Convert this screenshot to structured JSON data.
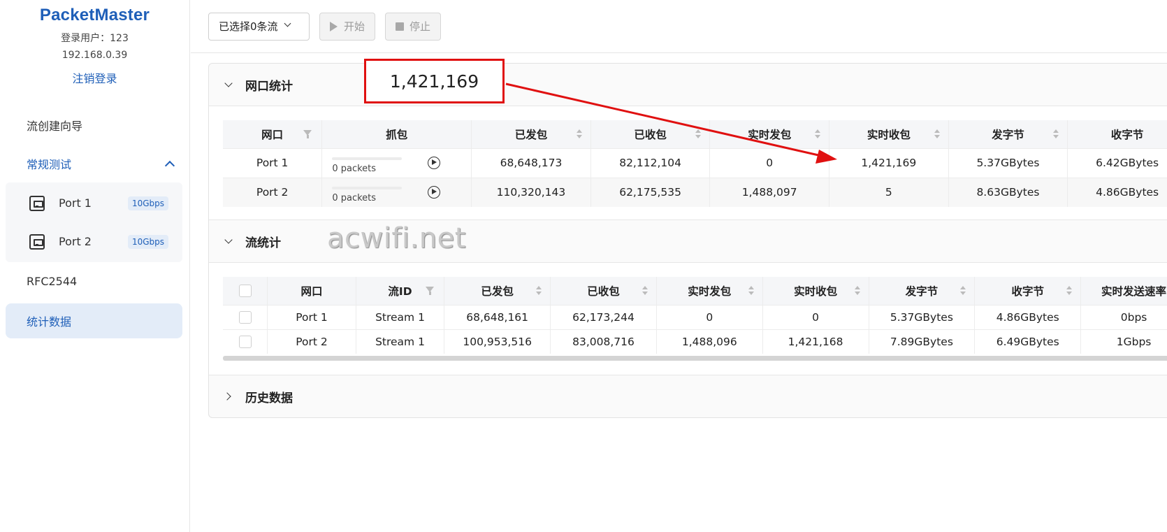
{
  "app": {
    "brand": "PacketMaster",
    "user_line": "登录用户：123",
    "ip": "192.168.0.39",
    "logout": "注销登录"
  },
  "nav": {
    "wizard": "流创建向导",
    "normal_test": "常规测试",
    "ports": [
      {
        "label": "Port 1",
        "speed": "10Gbps"
      },
      {
        "label": "Port 2",
        "speed": "10Gbps"
      }
    ],
    "rfc": "RFC2544",
    "stats": "统计数据"
  },
  "toolbar": {
    "stream_select": "已选择0条流",
    "start": "开始",
    "stop": "停止"
  },
  "port_stats": {
    "title": "网口统计",
    "columns": [
      "网口",
      "抓包",
      "已发包",
      "已收包",
      "实时发包",
      "实时收包",
      "发字节",
      "收字节"
    ],
    "rows": [
      {
        "port": "Port 1",
        "capture": "0 packets",
        "tx": "68,648,173",
        "rx": "82,112,104",
        "rt_tx": "0",
        "rt_rx": "1,421,169",
        "tx_bytes": "5.37GBytes",
        "rx_bytes": "6.42GBytes"
      },
      {
        "port": "Port 2",
        "capture": "0 packets",
        "tx": "110,320,143",
        "rx": "62,175,535",
        "rt_tx": "1,488,097",
        "rt_rx": "5",
        "tx_bytes": "8.63GBytes",
        "rx_bytes": "4.86GBytes"
      }
    ]
  },
  "flow_stats": {
    "title": "流统计",
    "columns": [
      "网口",
      "流ID",
      "已发包",
      "已收包",
      "实时发包",
      "实时收包",
      "发字节",
      "收字节",
      "实时发送速率"
    ],
    "rows": [
      {
        "port": "Port 1",
        "flow": "Stream 1",
        "tx": "68,648,161",
        "rx": "62,173,244",
        "rt_tx": "0",
        "rt_rx": "0",
        "tx_bytes": "5.37GBytes",
        "rx_bytes": "4.86GBytes",
        "rate": "0bps"
      },
      {
        "port": "Port 2",
        "flow": "Stream 1",
        "tx": "100,953,516",
        "rx": "83,008,716",
        "rt_tx": "1,488,096",
        "rt_rx": "1,421,168",
        "tx_bytes": "7.89GBytes",
        "rx_bytes": "6.49GBytes",
        "rate": "1Gbps"
      }
    ]
  },
  "history": {
    "title": "历史数据"
  },
  "annotation": {
    "callout_value": "1,421,169",
    "color": "#e01010"
  },
  "watermark": "acwifi.net",
  "colors": {
    "brand": "#1f5fb8",
    "active_bg": "#e3ecf8"
  }
}
